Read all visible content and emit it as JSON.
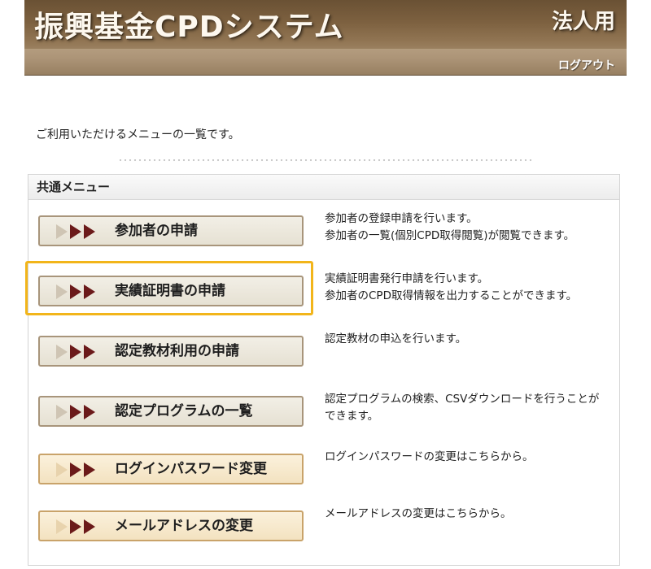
{
  "header": {
    "title": "振興基金CPDシステム",
    "badge": "法人用",
    "logout": "ログアウト"
  },
  "intro": "ご利用いただけるメニューの一覧です。",
  "panel": {
    "heading": "共通メニュー",
    "items": [
      {
        "label": "参加者の申請",
        "desc1": "参加者の登録申請を行います。",
        "desc2": "参加者の一覧(個別CPD取得閲覧)が閲覧できます。"
      },
      {
        "label": "実績証明書の申請",
        "desc1": "実績証明書発行申請を行います。",
        "desc2": "参加者のCPD取得情報を出力することができます。"
      },
      {
        "label": "認定教材利用の申請",
        "desc1": "認定教材の申込を行います。",
        "desc2": ""
      },
      {
        "label": "認定プログラムの一覧",
        "desc1": "認定プログラムの検索、CSVダウンロードを行うことが",
        "desc2": "できます。"
      },
      {
        "label": "ログインパスワード変更",
        "desc1": "ログインパスワードの変更はこちらから。",
        "desc2": ""
      },
      {
        "label": "メールアドレスの変更",
        "desc1": "メールアドレスの変更はこちらから。",
        "desc2": ""
      }
    ]
  },
  "colors": {
    "header_brown": "#7d6140",
    "button_border": "#a8957b",
    "button_alt_fill": "#f3e2c0",
    "arrow_dark": "#6b1a1a",
    "highlight": "#f2b51a"
  }
}
